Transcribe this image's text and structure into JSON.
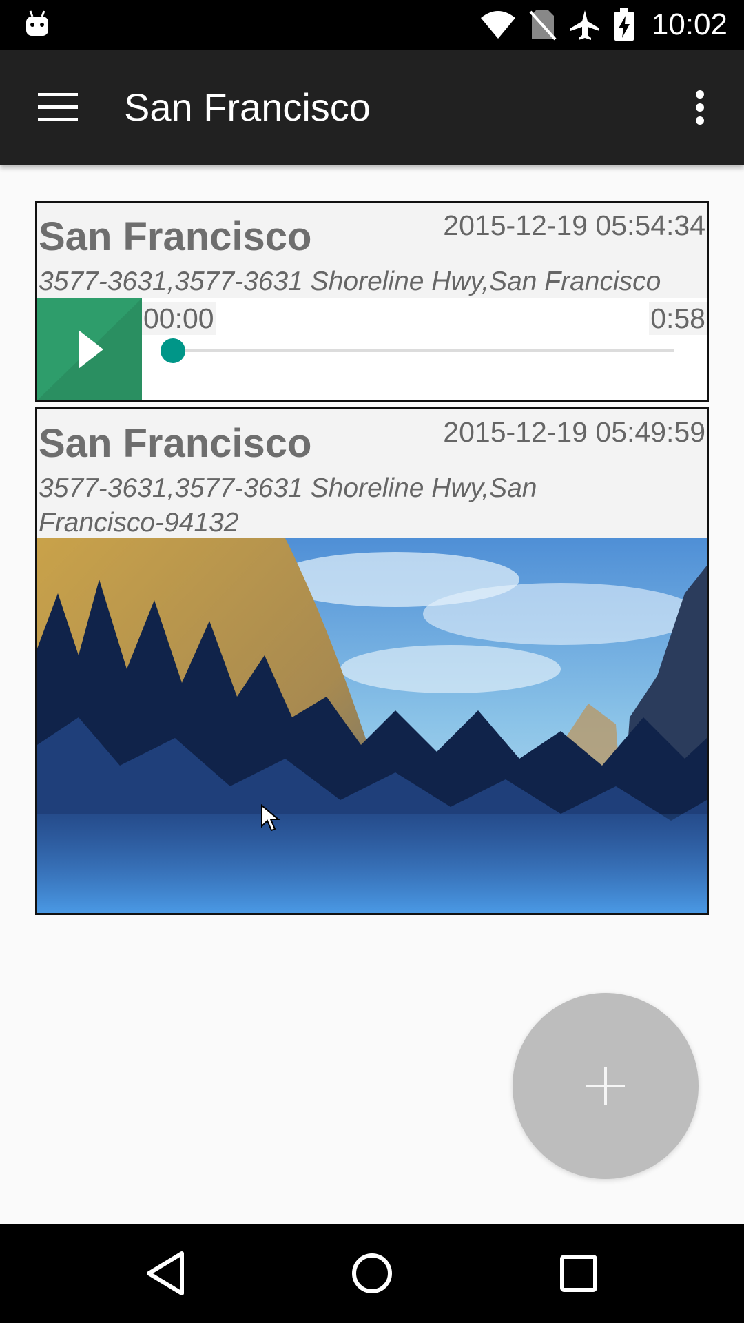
{
  "status_bar": {
    "time": "10:02",
    "icons": [
      "android-icon",
      "wifi-icon",
      "no-sim-icon",
      "airplane-mode-icon",
      "battery-charging-icon"
    ]
  },
  "toolbar": {
    "title": "San Francisco",
    "menu_icon": "hamburger-menu-icon",
    "more_icon": "more-vert-icon"
  },
  "entries": [
    {
      "type": "audio",
      "title": "San Francisco",
      "timestamp": "2015-12-19 05:54:34",
      "address": "3577-3631,3577-3631 Shoreline Hwy,San Francisco",
      "player": {
        "current_time": "00:00",
        "duration": "0:58",
        "progress": 0.0
      }
    },
    {
      "type": "photo",
      "title": "San Francisco",
      "timestamp": "2015-12-19 05:49:59",
      "address": "3577-3631,3577-3631 Shoreline Hwy,San Francisco-94132",
      "image_icon": "landscape-photo"
    }
  ],
  "fab": {
    "icon": "plus-icon",
    "color": "#bdbdbd"
  },
  "colors": {
    "toolbar": "#212121",
    "play_button": "#2e9d6b",
    "seek_accent": "#009688"
  },
  "nav_bar": {
    "icons": [
      "back-icon",
      "home-icon",
      "recents-icon"
    ]
  }
}
